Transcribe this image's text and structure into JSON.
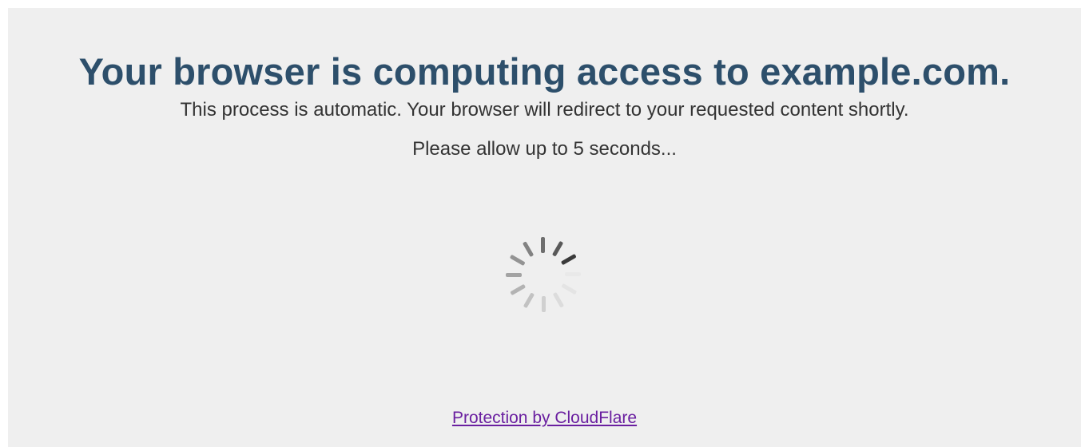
{
  "heading": "Your browser is computing access to example.com.",
  "message": "This process is automatic. Your browser will redirect to your requested content shortly.",
  "wait_notice": "Please allow up to 5 seconds...",
  "spinner": {
    "icon": "loading-spinner-icon",
    "bar_count": 12
  },
  "footer": {
    "link_text": "Protection by CloudFlare"
  },
  "colors": {
    "heading": "#2d4f6b",
    "text": "#333333",
    "link": "#6a1fa0",
    "background": "#efefef"
  }
}
